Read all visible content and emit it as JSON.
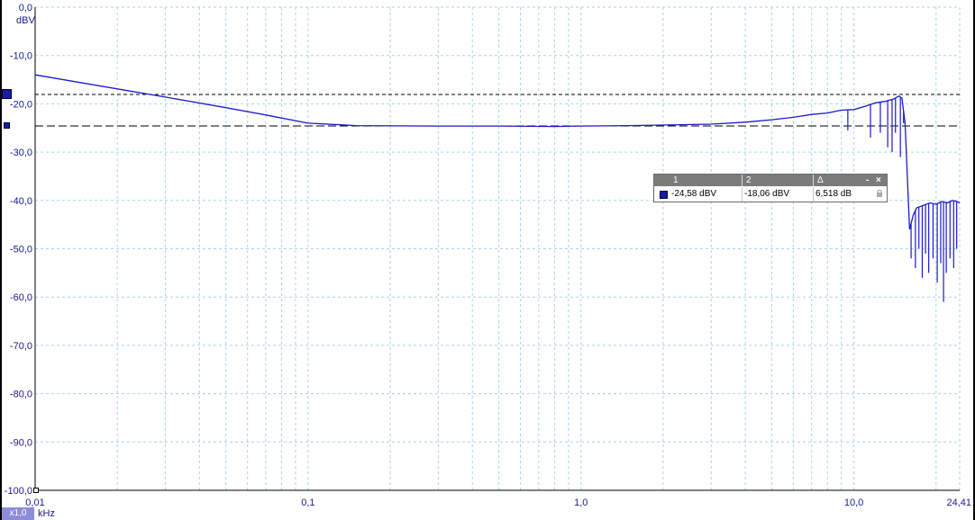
{
  "chart_data": {
    "type": "line",
    "x_scale": "log",
    "xlim": [
      0.01,
      24.41
    ],
    "ylim": [
      -100,
      0
    ],
    "grid": true,
    "x_unit": "kHz",
    "y_unit": "dBV",
    "y_ticks": [
      "0,0",
      "-10,0",
      "-20,0",
      "-30,0",
      "-40,0",
      "-50,0",
      "-60,0",
      "-70,0",
      "-80,0",
      "-90,0",
      "-100,0"
    ],
    "x_tick_labels": [
      {
        "value": 0.01,
        "label": "0,01"
      },
      {
        "value": 0.1,
        "label": "0,1"
      },
      {
        "value": 1.0,
        "label": "1,0"
      },
      {
        "value": 10.0,
        "label": "10,0"
      },
      {
        "value": 24.41,
        "label": "24,41"
      }
    ],
    "series": [
      {
        "color": "#1a1acc",
        "points": [
          [
            0.01,
            -14.0
          ],
          [
            0.02,
            -16.9
          ],
          [
            0.03,
            -18.6
          ],
          [
            0.05,
            -20.8
          ],
          [
            0.07,
            -22.3
          ],
          [
            0.1,
            -24.0
          ],
          [
            0.15,
            -24.5
          ],
          [
            0.3,
            -24.6
          ],
          [
            0.5,
            -24.6
          ],
          [
            0.8,
            -24.7
          ],
          [
            1.0,
            -24.6
          ],
          [
            1.5,
            -24.5
          ],
          [
            2.0,
            -24.4
          ],
          [
            3.0,
            -24.2
          ],
          [
            4.0,
            -23.8
          ],
          [
            5.0,
            -23.3
          ],
          [
            6.0,
            -22.8
          ],
          [
            7.0,
            -22.2
          ],
          [
            8.0,
            -21.9
          ],
          [
            9.0,
            -21.3
          ],
          [
            10.0,
            -21.2
          ],
          [
            11.0,
            -20.5
          ],
          [
            12.0,
            -19.8
          ],
          [
            13.0,
            -19.5
          ],
          [
            14.0,
            -19.0
          ],
          [
            14.6,
            -18.4
          ],
          [
            15.0,
            -18.8
          ],
          [
            15.4,
            -24.0
          ],
          [
            16.0,
            -46.0
          ],
          [
            16.5,
            -43.0
          ],
          [
            17.0,
            -41.5
          ],
          [
            18.0,
            -41.0
          ],
          [
            19.0,
            -40.5
          ],
          [
            20.0,
            -40.8
          ],
          [
            21.0,
            -40.2
          ],
          [
            22.0,
            -40.5
          ],
          [
            23.0,
            -40.0
          ],
          [
            24.0,
            -40.3
          ],
          [
            24.41,
            -40.5
          ]
        ],
        "dips": [
          [
            9.5,
            -25.5
          ],
          [
            11.5,
            -27.0
          ],
          [
            12.5,
            -26.0
          ],
          [
            13.3,
            -29.0
          ],
          [
            13.8,
            -30.0
          ],
          [
            14.2,
            -26.0
          ],
          [
            14.8,
            -31.0
          ],
          [
            15.2,
            -24.0
          ],
          [
            16.2,
            -52.0
          ],
          [
            16.8,
            -54.0
          ],
          [
            17.3,
            -50.0
          ],
          [
            17.8,
            -56.0
          ],
          [
            18.3,
            -51.0
          ],
          [
            18.8,
            -55.0
          ],
          [
            19.5,
            -52.0
          ],
          [
            20.2,
            -57.0
          ],
          [
            20.8,
            -53.0
          ],
          [
            21.3,
            -61.0
          ],
          [
            21.8,
            -55.0
          ],
          [
            22.5,
            -52.0
          ],
          [
            23.2,
            -54.0
          ],
          [
            23.8,
            -50.0
          ]
        ]
      }
    ],
    "cursors": [
      {
        "level": -18.06,
        "style": "short-dash"
      },
      {
        "level": -24.58,
        "style": "long-dash"
      }
    ]
  },
  "cursor_panel": {
    "col1_header": "1",
    "col2_header": "2",
    "delta_header": "Δ",
    "min_symbol": "-",
    "close_symbol": "×",
    "col1_value": "-24,58 dBV",
    "col2_value": "-18,06 dBV",
    "delta_value": "6,518 dB",
    "icons": {
      "series": "series-swatch-icon",
      "lock": "lock-icon"
    }
  },
  "zoom_badge": "x1,0",
  "x_unit_label": "kHz",
  "y_unit_label": "dBV"
}
